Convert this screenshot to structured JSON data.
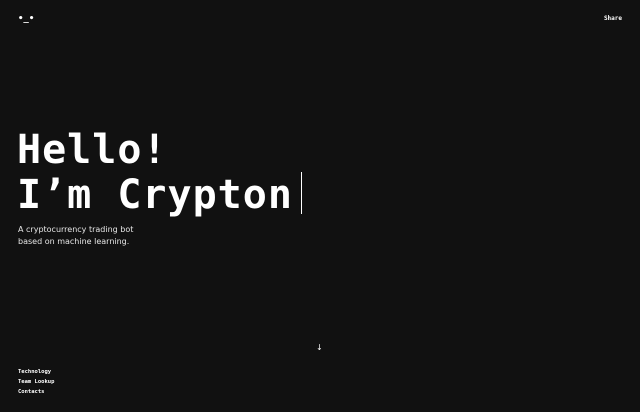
{
  "header": {
    "logo_text": "•_•",
    "share_label": "Share"
  },
  "hero": {
    "line1": "Hello!",
    "line2": "I’m Crypton"
  },
  "subtitle": {
    "line1": "A cryptocurrency trading bot",
    "line2": "based on machine learning."
  },
  "scroll": {
    "icon": "arrow-down-icon",
    "glyph": "↓"
  },
  "footer_nav": {
    "items": [
      {
        "label": "Technology"
      },
      {
        "label": "Team Lookup"
      },
      {
        "label": "Contacts"
      }
    ]
  },
  "colors": {
    "background": "#111111",
    "text": "#ffffff"
  }
}
